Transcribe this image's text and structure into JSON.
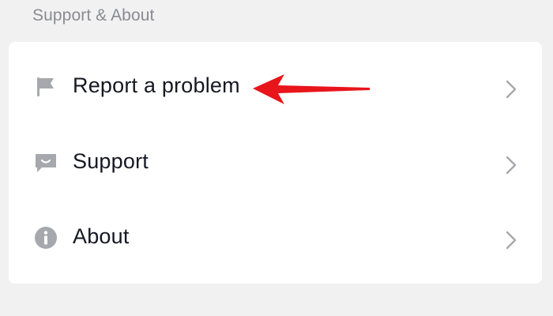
{
  "section": {
    "title": "Support & About"
  },
  "items": [
    {
      "label": "Report a problem",
      "icon": "flag-icon"
    },
    {
      "label": "Support",
      "icon": "chat-bubble-icon"
    },
    {
      "label": "About",
      "icon": "info-icon"
    }
  ],
  "colors": {
    "background": "#f1f1f2",
    "card": "#ffffff",
    "text": "#161823",
    "header_text": "#8a8b91",
    "icon": "#a7a8ad",
    "chevron": "#a7a8ad",
    "annotation_arrow": "#e8151b"
  },
  "annotation": {
    "type": "arrow",
    "points_to": "Report a problem"
  }
}
